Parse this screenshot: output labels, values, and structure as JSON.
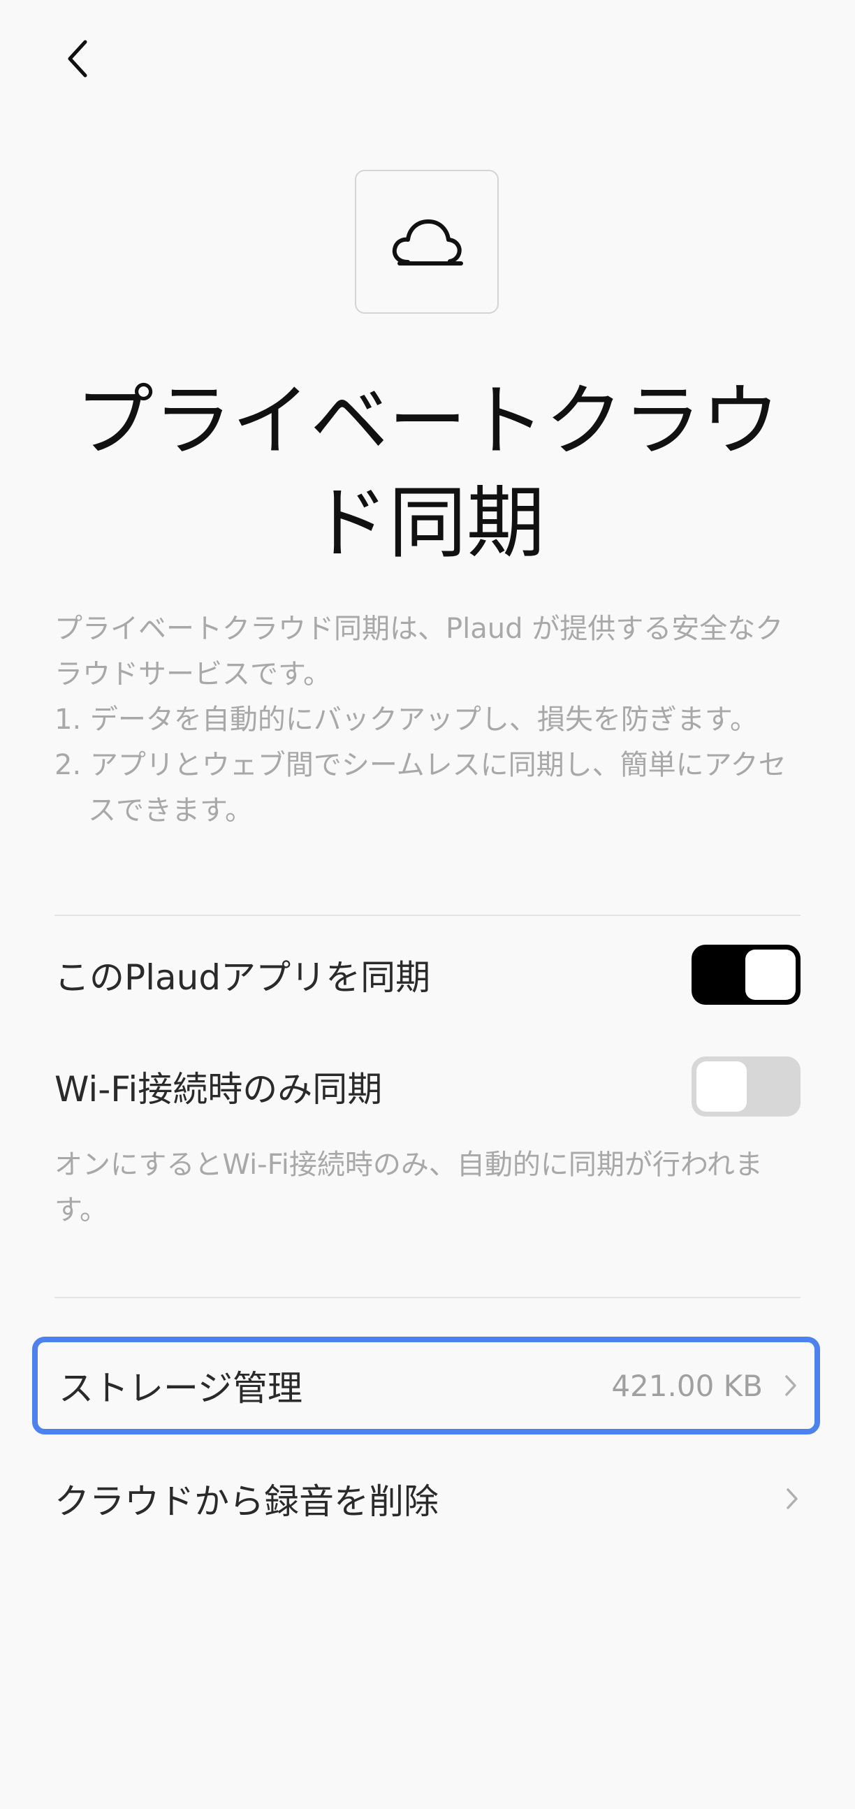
{
  "header": {
    "back_icon": "chevron-left-icon"
  },
  "hero": {
    "icon": "cloud-icon",
    "title": "プライベートクラウド同期"
  },
  "description": {
    "intro": "プライベートクラウド同期は、Plaud が提供する安全なクラウドサービスです。",
    "points": [
      "1. データを自動的にバックアップし、損失を防ぎます。",
      "2. アプリとウェブ間でシームレスに同期し、簡単にアクセスできます。"
    ]
  },
  "settings": {
    "sync_app": {
      "label": "このPlaudアプリを同期",
      "enabled": true
    },
    "wifi_only": {
      "label": "Wi-Fi接続時のみ同期",
      "enabled": false,
      "hint": "オンにするとWi-Fi接続時のみ、自動的に同期が行われます。"
    }
  },
  "menu": {
    "storage": {
      "label": "ストレージ管理",
      "value": "421.00 KB"
    },
    "delete_recordings": {
      "label": "クラウドから録音を削除"
    }
  },
  "colors": {
    "accent_focus": "#4b82f0",
    "toggle_on": "#000000",
    "toggle_off": "#d7d7d7",
    "muted_text": "#a8a8a8"
  }
}
